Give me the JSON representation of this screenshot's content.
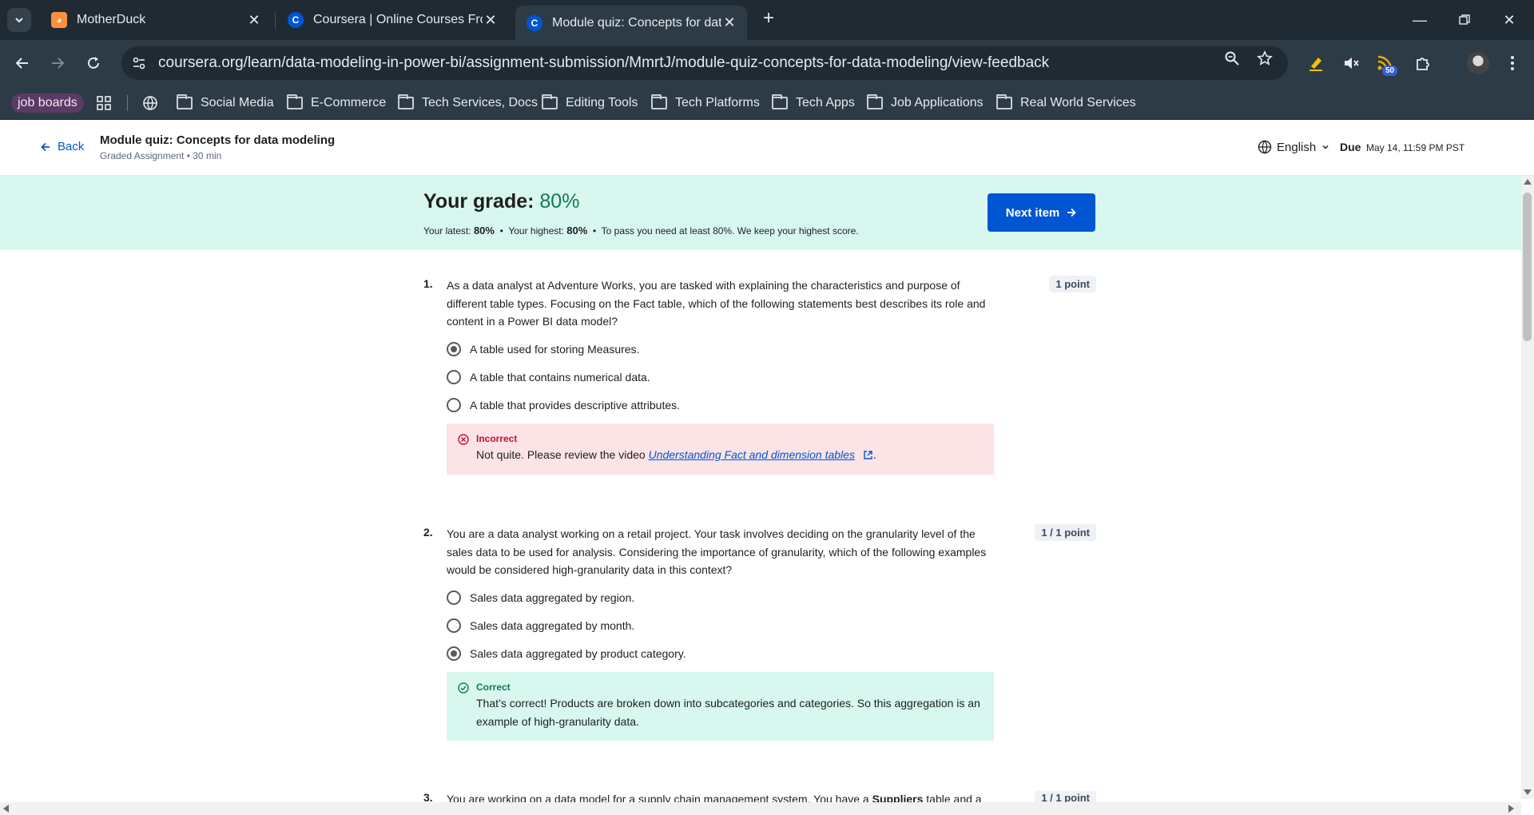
{
  "browser": {
    "tabs": [
      {
        "title": "MotherDuck",
        "favicon": "motherduck-favicon"
      },
      {
        "title": "Coursera | Online Courses From",
        "favicon": "coursera-favicon"
      },
      {
        "title": "Module quiz: Concepts for data",
        "favicon": "coursera-favicon",
        "active": true
      }
    ],
    "url": "coursera.org/learn/data-modeling-in-power-bi/assignment-submission/MmrtJ/module-quiz-concepts-for-data-modeling/view-feedback",
    "extension_badge": "50",
    "bookmarks": {
      "job_boards": "job boards",
      "items": [
        "Social Media",
        "E-Commerce",
        "Tech Services, Docs",
        "Editing Tools",
        "Tech Platforms",
        "Tech Apps",
        "Job Applications",
        "Real World Services"
      ]
    }
  },
  "header": {
    "back_label": "Back",
    "module_title": "Module quiz: Concepts for data modeling",
    "module_subtitle": "Graded Assignment • 30 min",
    "language": "English",
    "due_label": "Due",
    "due_value": "May 14, 11:59 PM PST"
  },
  "grade": {
    "label": "Your grade:",
    "value": "80%",
    "latest_label": "Your latest:",
    "latest_value": "80%",
    "highest_label": "Your highest:",
    "highest_value": "80%",
    "pass_note": "To pass you need at least 80%. We keep your highest score.",
    "next_label": "Next item"
  },
  "questions": [
    {
      "number": "1.",
      "text": "As a data analyst at Adventure Works, you are tasked with explaining the characteristics and purpose of different table types. Focusing on the Fact table, which of the following statements best describes its role and content in a Power BI data model?",
      "points": "1 point",
      "options": [
        "A table used for storing Measures.",
        "A table that contains numerical data.",
        "A table that provides descriptive attributes."
      ],
      "selected": 0,
      "feedback": {
        "status": "Incorrect",
        "text_before": "Not quite. Please review the video",
        "link": "Understanding Fact and dimension tables",
        "text_after": "."
      }
    },
    {
      "number": "2.",
      "text": "You are a data analyst working on a retail project. Your task involves deciding on the granularity level of the sales data to be used for analysis. Considering the importance of granularity, which of the following examples would be considered high-granularity data in this context?",
      "points": "1 / 1 point",
      "options": [
        "Sales data aggregated by region.",
        "Sales data aggregated by month.",
        "Sales data aggregated by product category."
      ],
      "selected": 2,
      "feedback": {
        "status": "Correct",
        "text": "That’s correct! Products are broken down into subcategories and categories. So this aggregation is an example of high-granularity data."
      }
    },
    {
      "number": "3.",
      "text_before": "You are working on a data model for a supply chain management system. You have a ",
      "text_bold": "Suppliers",
      "text_after": " table and a",
      "points": "1 / 1 point"
    }
  ]
}
